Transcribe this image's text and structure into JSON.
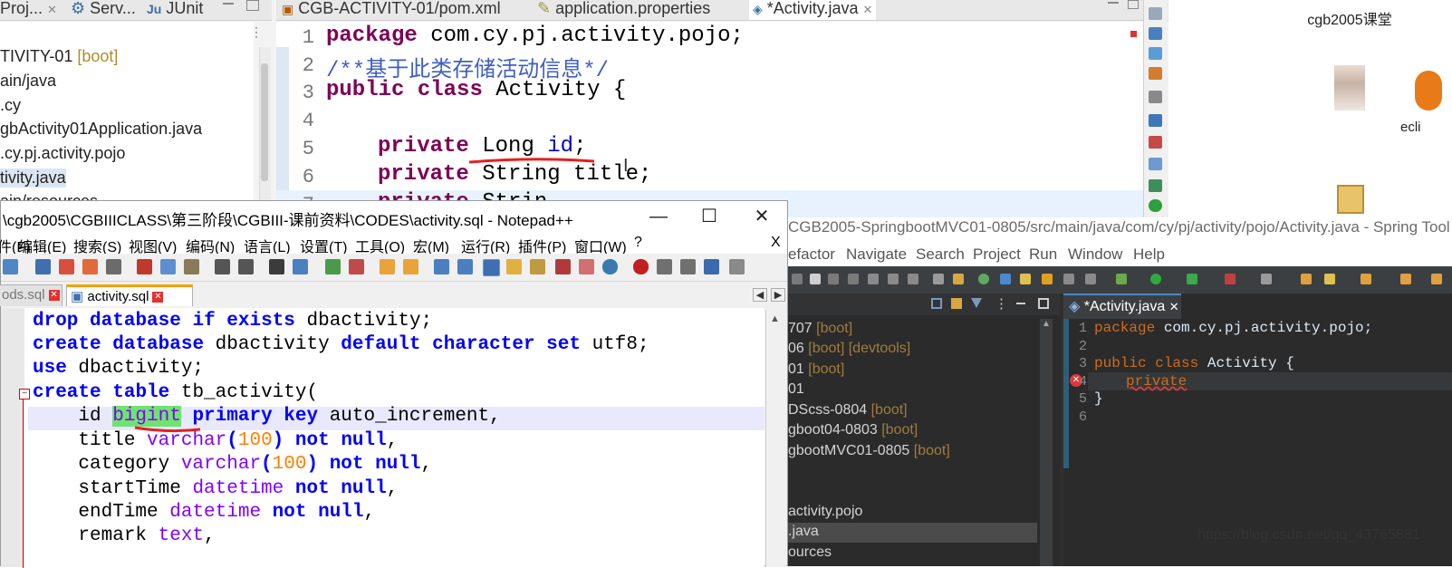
{
  "eclipse": {
    "left_tabs": [
      "Proj...",
      "Serv...",
      "JUnit"
    ],
    "tree": [
      {
        "label": "TIVITY-01",
        "badge": "[boot]"
      },
      {
        "label": "ain/java",
        "badge": ""
      },
      {
        "label": ".cy",
        "badge": ""
      },
      {
        "label": "gbActivity01Application.java",
        "badge": ""
      },
      {
        "label": ".cy.pj.activity.pojo",
        "badge": ""
      },
      {
        "label": "tivity.java",
        "badge": ""
      },
      {
        "label": "ain/resources",
        "badge": ""
      }
    ],
    "editor_tabs": [
      "CGB-ACTIVITY-01/pom.xml",
      "application.properties",
      "*Activity.java"
    ],
    "code": {
      "line1": {
        "no": "1",
        "kw": "package",
        "rest": " com.cy.pj.activity.pojo;"
      },
      "line2": {
        "no": "2",
        "comment": "/**基于此类存储活动信息*/"
      },
      "line3": {
        "no": "3",
        "kw1": "public",
        "kw2": "class",
        "rest": " Activity {"
      },
      "line4": {
        "no": "4"
      },
      "line5": {
        "no": "5",
        "kw": "private",
        "type": " Long ",
        "field": "id",
        "end": ";"
      },
      "line6": {
        "no": "6",
        "kw": "private",
        "rest": " String title;"
      },
      "line7": {
        "no": "7",
        "kw": "private",
        "rest": " Strin"
      }
    }
  },
  "desktop": {
    "icon_label": "cgb2005课堂",
    "partial_label": "ecli"
  },
  "notepad": {
    "title": "\\cgb2005\\CGBIIICLASS\\第三阶段\\CGBIII-课前资料\\CODES\\activity.sql - Notepad++",
    "menu": [
      "文件(F)",
      "编辑(E)",
      "搜索(S)",
      "视图(V)",
      "编码(N)",
      "语言(L)",
      "设置(T)",
      "工具(O)",
      "宏(M)",
      "运行(R)",
      "插件(P)",
      "窗口(W)",
      "?"
    ],
    "close_x": "X",
    "tabs": [
      "ods.sql",
      "activity.sql"
    ],
    "sql": {
      "l1": {
        "k1": "drop",
        "k2": "database",
        "k3": "if",
        "k4": "exists",
        "rest": " dbactivity;"
      },
      "l2": {
        "k1": "create",
        "k2": "database",
        "mid": " dbactivity ",
        "k3": "default",
        "k4": "character",
        "k5": "set",
        "rest": " utf8;"
      },
      "l3": {
        "k1": "use",
        "rest": " dbactivity;"
      },
      "l4": {
        "k1": "create",
        "k2": "table",
        "rest": " tb_activity("
      },
      "l5": {
        "pre": "    id ",
        "type": "bigint",
        "k1": "primary",
        "k2": "key",
        "rest": " auto_increment,"
      },
      "l6": {
        "pre": "    title ",
        "type": "varchar",
        "p1": "(",
        "num": "100",
        "p2": ")",
        "k1": "not",
        "k2": "null",
        "end": ","
      },
      "l7": {
        "pre": "    category ",
        "type": "varchar",
        "p1": "(",
        "num": "100",
        "p2": ")",
        "k1": "not",
        "k2": "null",
        "end": ","
      },
      "l8": {
        "pre": "    startTime ",
        "type": "datetime",
        "k1": "not",
        "k2": "null",
        "end": ","
      },
      "l9": {
        "pre": "    endTime ",
        "type": "datetime",
        "k1": "not",
        "k2": "null",
        "end": ","
      },
      "l10": {
        "pre": "    remark ",
        "type": "text",
        "end": ","
      }
    }
  },
  "sts": {
    "title": "CGB2005-SpringbootMVC01-0805/src/main/java/com/cy/pj/activity/pojo/Activity.java - Spring Tool",
    "menu": [
      "efactor",
      "Navigate",
      "Search",
      "Project",
      "Run",
      "Window",
      "Help"
    ],
    "projects": [
      {
        "label": "707 ",
        "badge": "[boot]"
      },
      {
        "label": "06 ",
        "badge": "[boot] [devtools]"
      },
      {
        "label": "01 ",
        "badge": "[boot]"
      },
      {
        "label": "01",
        "badge": ""
      },
      {
        "label": "DScss-0804 ",
        "badge": "[boot]"
      },
      {
        "label": "gboot04-0803 ",
        "badge": "[boot]"
      },
      {
        "label": "gbootMVC01-0805 ",
        "badge": "[boot]"
      },
      {
        "label": "",
        "badge": ""
      },
      {
        "label": "activity.pojo",
        "badge": ""
      },
      {
        "label": ".java",
        "badge": ""
      },
      {
        "label": "ources",
        "badge": ""
      }
    ],
    "editor_tab": "*Activity.java",
    "code": {
      "l1": {
        "no": "1",
        "kw": "package",
        "rest": " com.cy.pj.activity.pojo;"
      },
      "l2": {
        "no": "2"
      },
      "l3": {
        "no": "3",
        "kw1": "public",
        "kw2": "class",
        "rest": " Activity {"
      },
      "l4": {
        "no": "4",
        "err": "private"
      },
      "l5": {
        "no": "5",
        "rest": "}"
      },
      "l6": {
        "no": "6"
      }
    }
  },
  "watermark": "https://blog.csdn.net/qq_43765881"
}
